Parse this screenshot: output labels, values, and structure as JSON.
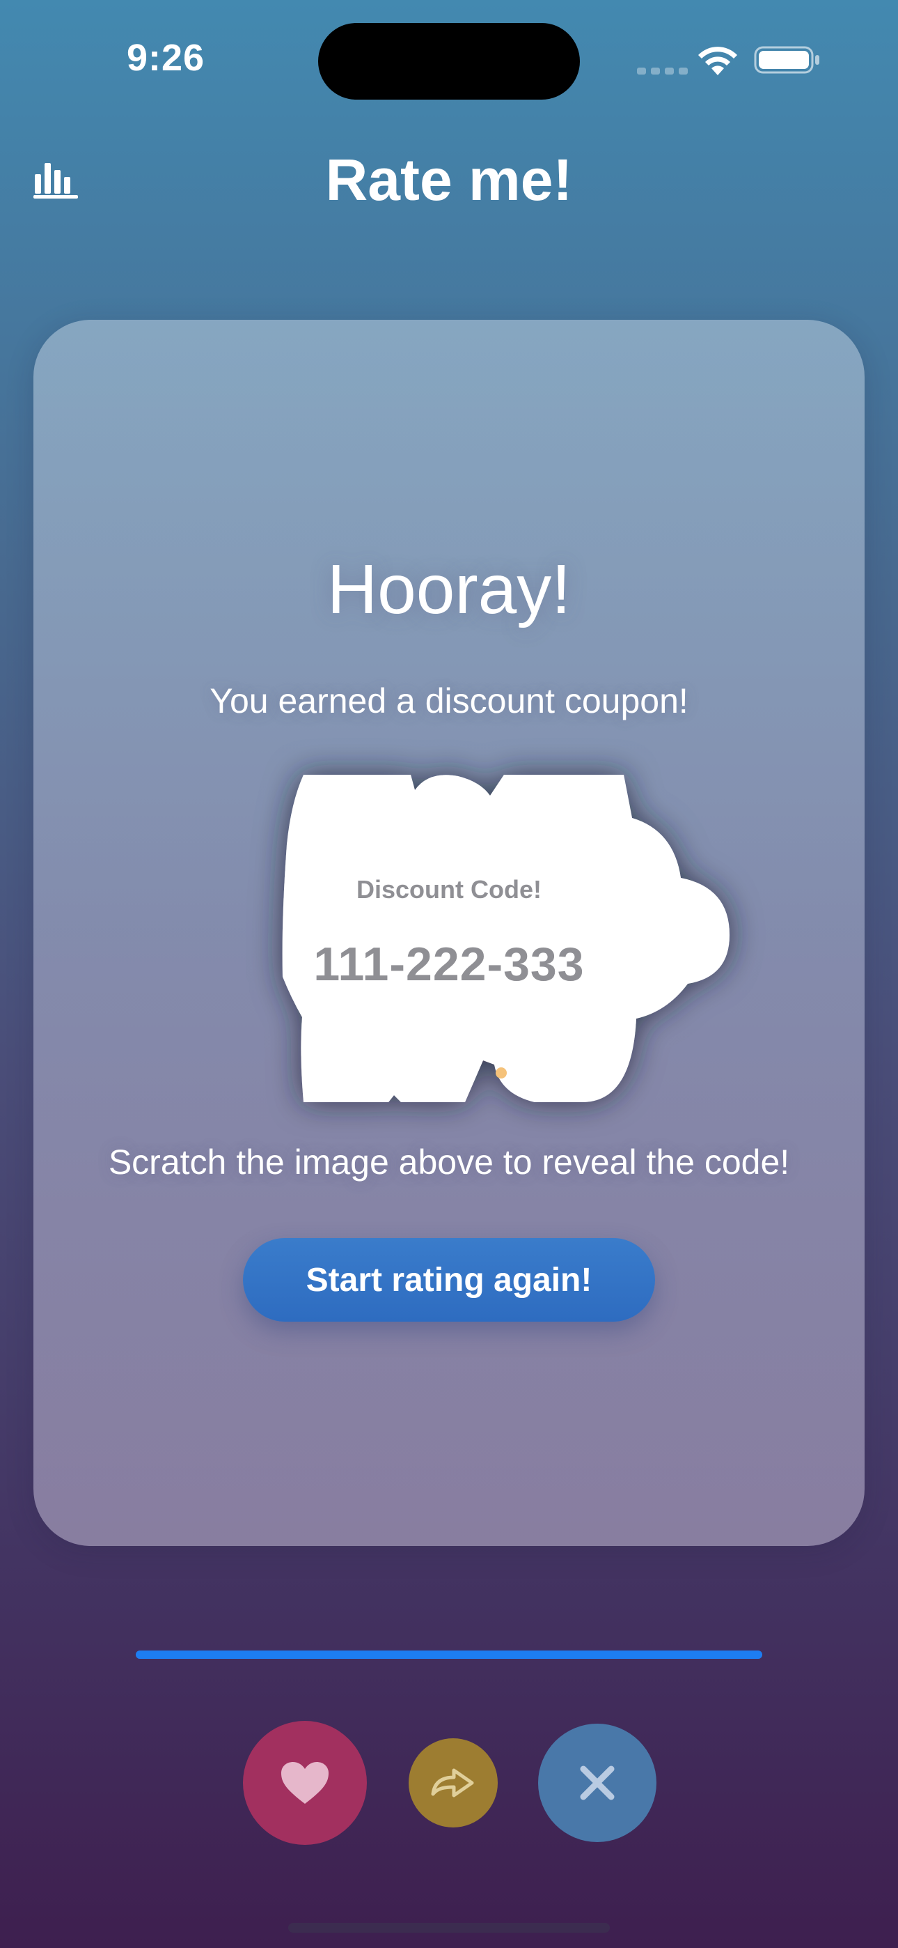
{
  "status_bar": {
    "time": "9:26"
  },
  "header": {
    "title": "Rate me!",
    "chart_icon": "bar-chart-icon"
  },
  "card": {
    "heading": "Hooray!",
    "subtitle": "You earned a discount coupon!",
    "coupon": {
      "label": "Discount Code!",
      "code": "111-222-333"
    },
    "hint": "Scratch the image above to reveal the code!",
    "restart_label": "Start rating again!"
  },
  "progress": {
    "value": 1.0
  },
  "actions": {
    "like_icon": "heart-icon",
    "skip_icon": "share-arrow-icon",
    "dislike_icon": "close-icon"
  },
  "colors": {
    "accent_blue": "#1d7df2",
    "like": "#a2305f",
    "skip": "#9d7d31",
    "dislike": "#4978a9",
    "button": "#2e6cc0"
  }
}
